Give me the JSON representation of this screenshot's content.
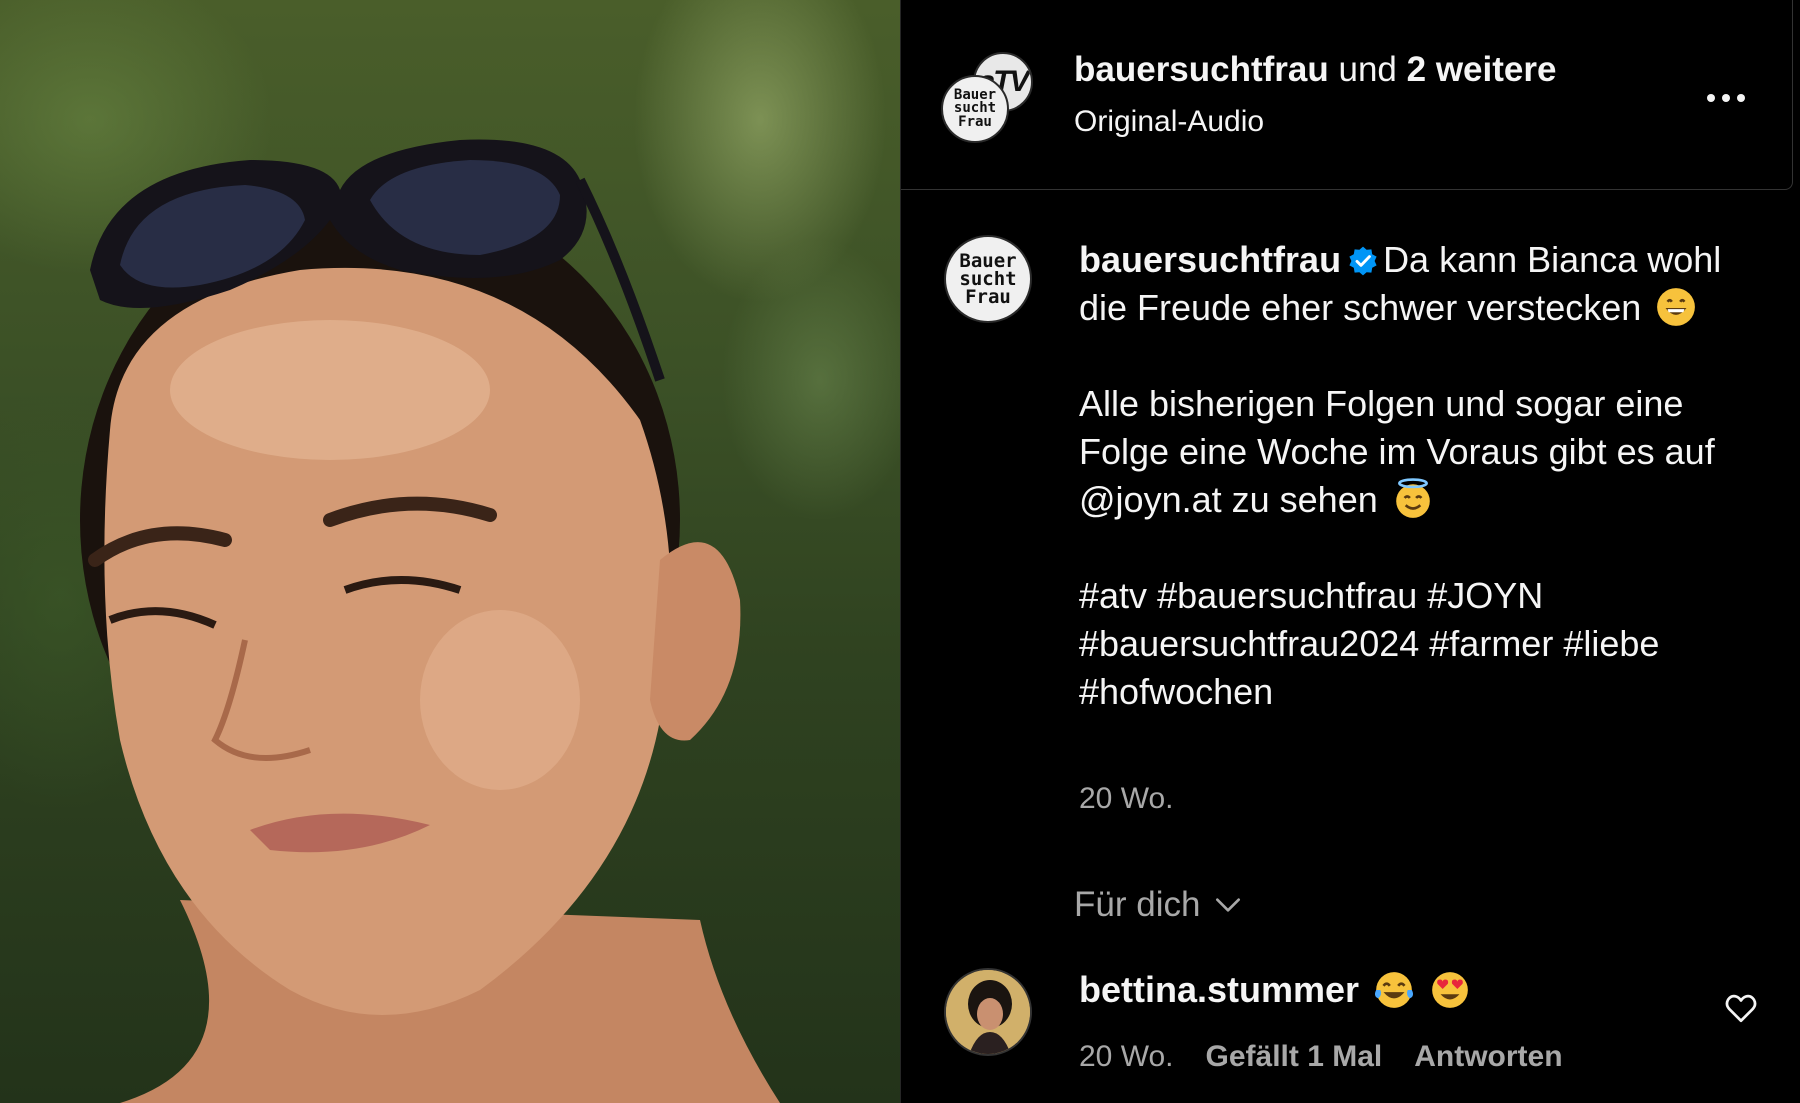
{
  "post": {
    "header": {
      "author": "bauersuchtfrau",
      "joiner": " und ",
      "others": "2 weitere",
      "audio": "Original-Audio",
      "avatar_logo_lines": [
        "Bauer",
        "sucht",
        "Frau"
      ],
      "second_avatar_logo": "aTV"
    },
    "caption": {
      "username": "bauersuchtfrau",
      "verified": true,
      "text_1": "Da kann Bianca wohl die Freude eher schwer verstecken",
      "emoji_1": "grinning-face",
      "text_2a": "Alle bisherigen Folgen und sogar eine Folge eine Woche im Voraus gibt es auf ",
      "mention": "@joyn.at",
      "text_2b": " zu sehen",
      "emoji_2": "smiling-face-with-halo",
      "hashtags": [
        "#atv",
        "#bauersuchtfrau",
        "#JOYN",
        "#bauersuchtfrau2024",
        "#farmer",
        "#liebe",
        "#hofwochen"
      ],
      "time": "20 Wo."
    },
    "comments_filter": {
      "label": "Für dich"
    },
    "comments": [
      {
        "username": "bettina.stummer",
        "emojis": [
          "face-with-tears-of-joy",
          "smiling-face-with-heart-eyes"
        ],
        "time": "20 Wo.",
        "likes_label": "Gefällt 1 Mal",
        "reply_label": "Antworten"
      }
    ]
  },
  "colors": {
    "background": "#000000",
    "text": "#f5f5f5",
    "secondary_text": "#a8a8a8",
    "verified_blue": "#0095f6",
    "divider": "#333333"
  },
  "icons": {
    "more": "more-horizontal-icon",
    "chevron": "chevron-down-icon",
    "like": "heart-outline-icon",
    "verified": "verified-badge-icon"
  }
}
